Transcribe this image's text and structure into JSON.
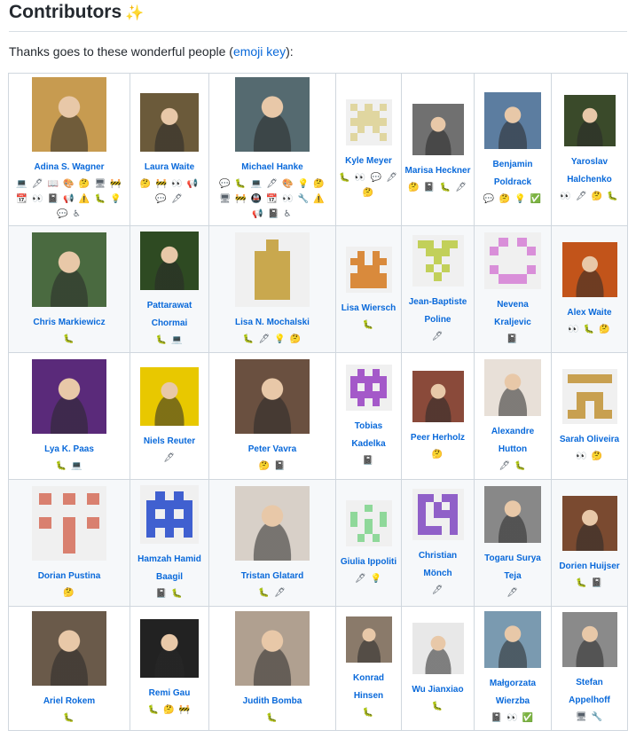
{
  "header": {
    "title": "Contributors",
    "sparkle": "✨"
  },
  "intro": {
    "before": "Thanks goes to these wonderful people (",
    "link": "emoji key",
    "after": "):"
  },
  "rows": [
    [
      {
        "name": "Adina S. Wagner",
        "icons": "💻 🖋 📖 🎨 🤔 🖥 🚧 📆 👀 📓 📢 ⚠️ 🐛 💡 💬 ♿"
      },
      {
        "name": "Laura Waite",
        "icons": "🤔 🚧 👀 📢 💬 🖋"
      },
      {
        "name": "Michael Hanke",
        "icons": "💬 🐛 💻 🖋 🎨 💡 🤔 🖥 🚧 🚇 📆 👀 🔧 ⚠️ 📢 📓 ♿"
      },
      {
        "name": "Kyle Meyer",
        "icons": "🐛 👀 💬 🖋 🤔"
      },
      {
        "name": "Marisa Heckner",
        "icons": "🤔 📓 🐛 🖋"
      },
      {
        "name": "Benjamin Poldrack",
        "icons": "💬 🤔 💡 ✅"
      },
      {
        "name": "Yaroslav Halchenko",
        "icons": "👀 🖋 🤔 🐛"
      }
    ],
    [
      {
        "name": "Chris Markiewicz",
        "icons": "🐛"
      },
      {
        "name": "Pattarawat Chormai",
        "icons": "🐛 💻"
      },
      {
        "name": "Lisa N. Mochalski",
        "icons": "🐛 🖋 💡 🤔"
      },
      {
        "name": "Lisa Wiersch",
        "icons": "🐛"
      },
      {
        "name": "Jean-Baptiste Poline",
        "icons": "🖋"
      },
      {
        "name": "Nevena Kraljevic",
        "icons": "📓"
      },
      {
        "name": "Alex Waite",
        "icons": "👀 🐛 🤔"
      }
    ],
    [
      {
        "name": "Lya K. Paas",
        "icons": "🐛 💻"
      },
      {
        "name": "Niels Reuter",
        "icons": "🖋"
      },
      {
        "name": "Peter Vavra",
        "icons": "🤔 📓"
      },
      {
        "name": "Tobias Kadelka",
        "icons": "📓"
      },
      {
        "name": "Peer Herholz",
        "icons": "🤔"
      },
      {
        "name": "Alexandre Hutton",
        "icons": "🖋 🐛"
      },
      {
        "name": "Sarah Oliveira",
        "icons": "👀 🤔"
      }
    ],
    [
      {
        "name": "Dorian Pustina",
        "icons": "🤔"
      },
      {
        "name": "Hamzah Hamid Baagil",
        "icons": "📓 🐛"
      },
      {
        "name": "Tristan Glatard",
        "icons": "🐛 🖋"
      },
      {
        "name": "Giulia Ippoliti",
        "icons": "🖋 💡"
      },
      {
        "name": "Christian Mönch",
        "icons": "🖋"
      },
      {
        "name": "Togaru Surya Teja",
        "icons": "🖋"
      },
      {
        "name": "Dorien Huijser",
        "icons": "🐛 📓"
      }
    ],
    [
      {
        "name": "Ariel Rokem",
        "icons": "🐛"
      },
      {
        "name": "Remi Gau",
        "icons": "🐛 🤔 🚧"
      },
      {
        "name": "Judith Bomba",
        "icons": "🐛"
      },
      {
        "name": "Konrad Hinsen",
        "icons": "🐛"
      },
      {
        "name": "Wu Jianxiao",
        "icons": "🐛"
      },
      {
        "name": "Małgorzata Wierzba",
        "icons": "📓 👀 ✅"
      },
      {
        "name": "Stefan Appelhoff",
        "icons": "🖥 🔧"
      }
    ]
  ]
}
